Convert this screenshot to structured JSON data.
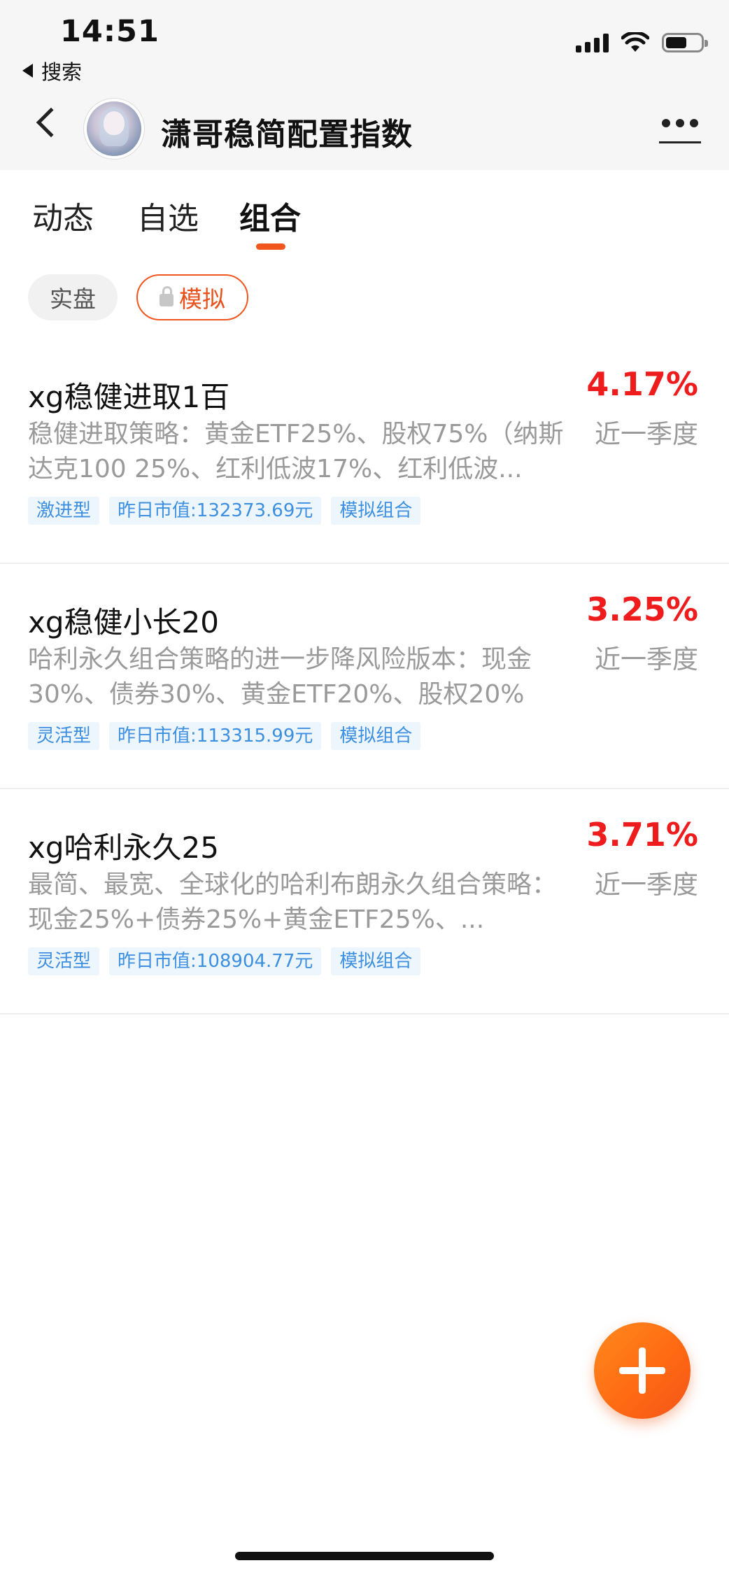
{
  "status_bar": {
    "time": "14:51",
    "back_app_label": "搜索",
    "battery_level": 0.6
  },
  "header": {
    "title": "潇哥稳简配置指数"
  },
  "tabs": [
    {
      "label": "动态",
      "active": false
    },
    {
      "label": "自选",
      "active": false
    },
    {
      "label": "组合",
      "active": true
    }
  ],
  "filters": {
    "real": "实盘",
    "simulated": "模拟",
    "selected": "模拟"
  },
  "portfolios": [
    {
      "name": "xg稳健进取1百",
      "return": "4.17%",
      "period": "近一季度",
      "description": "稳健进取策略：黄金ETF25%、股权75%（纳斯达克100 25%、红利低波17%、红利低波...",
      "tags": [
        "激进型",
        "昨日市值:132373.69元",
        "模拟组合"
      ]
    },
    {
      "name": "xg稳健小长20",
      "return": "3.25%",
      "period": "近一季度",
      "description": "哈利永久组合策略的进一步降风险版本：现金30%、债券30%、黄金ETF20%、股权20%",
      "tags": [
        "灵活型",
        "昨日市值:113315.99元",
        "模拟组合"
      ]
    },
    {
      "name": "xg哈利永久25",
      "return": "3.71%",
      "period": "近一季度",
      "description": "最简、最宽、全球化的哈利布朗永久组合策略：现金25%+债券25%+黄金ETF25%、...",
      "tags": [
        "灵活型",
        "昨日市值:108904.77元",
        "模拟组合"
      ]
    }
  ],
  "colors": {
    "accent": "#f1561f",
    "return_positive": "#ee1c1c",
    "tag_text": "#3d8fe0",
    "tag_bg": "#edf5fd"
  }
}
